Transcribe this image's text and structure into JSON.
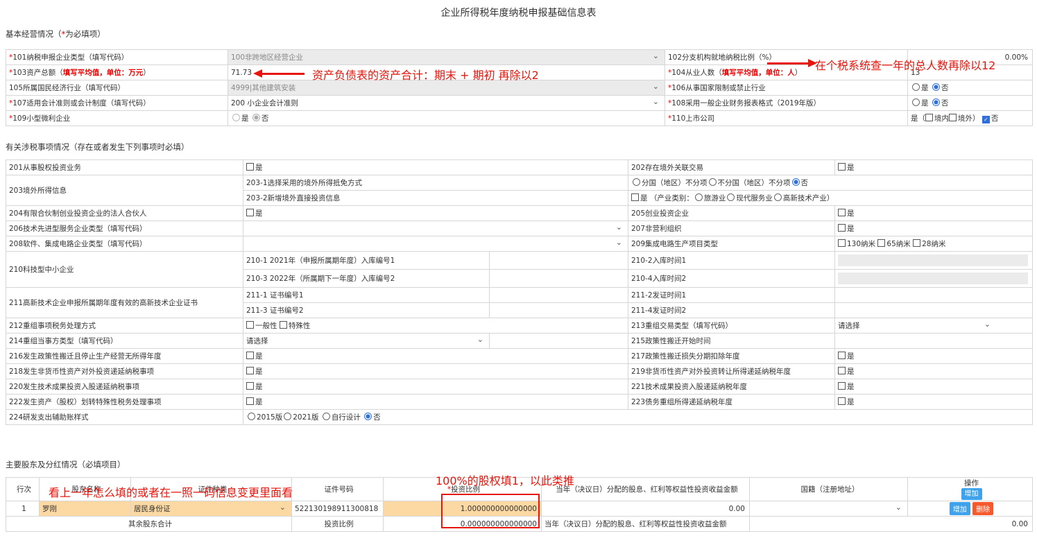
{
  "title": "企业所得税年度纳税申报基础信息表",
  "sections": {
    "basic": "基本经营情况（",
    "basic_req": "*",
    "basic_tail": "为必填项）",
    "tax": "有关涉税事项情况（存在或者发生下列事项时必填）",
    "shareholder": "主要股东及分红情况（必填项目）"
  },
  "basic": {
    "r101_label": "101纳税申报企业类型（填写代码）",
    "r101_value": "100非跨地区经营企业",
    "r102_label": "102分支机构就地纳税比例（%）",
    "r102_value": "0.00%",
    "r103_label": "103资产总额（",
    "r103_hint": "填写平均值，单位：万元",
    "r103_tail": "）",
    "r103_value": "71.73",
    "r104_label": "104从业人数（",
    "r104_hint": "填写平均值，单位：人",
    "r104_tail": "）",
    "r104_value": "13",
    "r105_label": "105所属国民经济行业（填写代码）",
    "r105_value": "4999|其他建筑安装",
    "r106_label": "106从事国家限制或禁止行业",
    "r107_label": "107适用会计准则或会计制度（填写代码）",
    "r107_value": "200 小企业会计准则",
    "r108_label": "108采用一般企业财务报表格式（2019年版）",
    "r109_label": "109小型微利企业",
    "r110_label": "110上市公司",
    "yes": "是",
    "no": "否",
    "r110_yes": "是（",
    "r110_domestic": "境内",
    "r110_foreign": "境外）",
    "r110_no": "否"
  },
  "tax": {
    "r201": "201从事股权投资业务",
    "r202": "202存在境外关联交易",
    "r203": "203境外所得信息",
    "r203_1": "203-1选择采用的境外所得抵免方式",
    "r203_1_opt1": "分国（地区）不分项",
    "r203_1_opt2": "不分国（地区）不分项",
    "r203_1_opt3": "否",
    "r203_2": "203-2新增境外直接投资信息",
    "r203_2_val": "是 （产业类别：",
    "r203_2_o1": "旅游业",
    "r203_2_o2": "现代服务业",
    "r203_2_o3": "高新技术产业）",
    "r204": "204有限合伙制创业投资企业的法人合伙人",
    "r205": "205创业投资企业",
    "r206": "206技术先进型服务企业类型（填写代码）",
    "r207": "207非营利组织",
    "r208": "208软件、集成电路企业类型（填写代码）",
    "r209": "209集成电路生产项目类型",
    "r209_o1": "130纳米",
    "r209_o2": "65纳米",
    "r209_o3": "28纳米",
    "r210": "210科技型中小企业",
    "r210_1": "210-1  2021年（申报所属期年度）入库编号1",
    "r210_2": "210-2入库时间1",
    "r210_3": "210-3  2022年（所属期下一年度）入库编号2",
    "r210_4": "210-4入库时间2",
    "r211": "211高新技术企业申报所属期年度有效的高新技术企业证书",
    "r211_1": "211-1 证书编号1",
    "r211_2": "211-2发证时间1",
    "r211_3": "211-3 证书编号2",
    "r211_4": "211-4发证时间2",
    "r212": "212重组事项税务处理方式",
    "r212_o1": "一般性",
    "r212_o2": "特殊性",
    "r213": "213重组交易类型（填写代码）",
    "r213_val": "请选择",
    "r214": "214重组当事方类型（填写代码）",
    "r214_val": "请选择",
    "r215": "215政策性搬迁开始时间",
    "r216": "216发生政策性搬迁且停止生产经营无所得年度",
    "r217": "217政策性搬迁损失分期扣除年度",
    "r218": "218发生非货币性资产对外投资递延纳税事项",
    "r219": "219非货币性资产对外投资转让所得递延纳税年度",
    "r220": "220发生技术成果投资入股递延纳税事项",
    "r221": "221技术成果投资入股递延纳税年度",
    "r222": "222发生资产（股权）划转特殊性税务处理事项",
    "r223": "223债务重组所得递延纳税年度",
    "r224": "224研发支出辅助账样式",
    "r224_o1": "2015版",
    "r224_o2": "2021版",
    "r224_o3": "自行设计",
    "r224_o4": "否",
    "yes": "是"
  },
  "shareholders": {
    "headers": {
      "idx": "行次",
      "name": "股东名称",
      "id_type": "证件种类",
      "id_no": "证件号码",
      "ratio_req": "*",
      "ratio": "投资比例",
      "dividend": "当年（决议日）分配的股息、红利等权益性投资收益金额",
      "nation": "国籍（注册地址）",
      "op": "操作",
      "add": "增加"
    },
    "row": {
      "idx": "1",
      "name": "罗刚",
      "id_type": "居民身份证",
      "id_no": "522130198911300818",
      "ratio": "1.000000000000000",
      "dividend": "0.00",
      "add": "增加",
      "del": "删除"
    },
    "other": {
      "label": "其余股东合计",
      "ratio_label": "投资比例",
      "ratio": "0.000000000000000",
      "dividend_label": "当年（决议日）分配的股息、红利等权益性投资收益金额",
      "dividend": "0.00"
    }
  },
  "annotations": {
    "a1": "资产负债表的资产合计：期末 + 期初 再除以2",
    "a2": "在个税系统查一年的总人数再除以12",
    "a3": "100%的股权填1，以此类推",
    "a4": "看上一年怎么填的或者在一照一码信息变更里面看"
  },
  "colors": {
    "annotation": "#e8150c",
    "required": "#e00000",
    "highlight": "#fcd9a3",
    "button_blue": "#3ea2ec",
    "button_red": "#f5592c"
  }
}
